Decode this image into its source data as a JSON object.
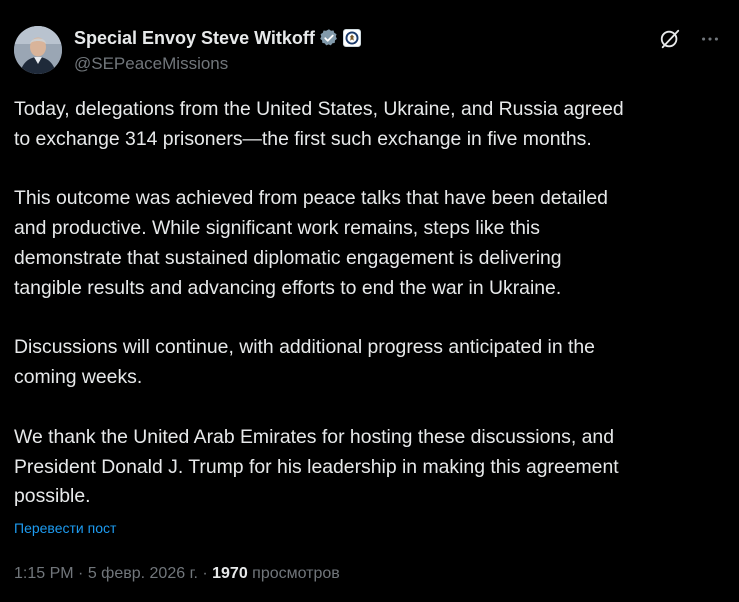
{
  "author": {
    "display_name": "Special Envoy Steve Witkoff",
    "handle": "@SEPeaceMissions",
    "verified_badge_icon": "verified-badge-icon",
    "affiliation_icon": "state-department-seal-icon"
  },
  "header_actions": {
    "grok_icon": "grok-icon",
    "more_icon": "more-icon"
  },
  "tweet": {
    "lines": [
      "Today, delegations from the United States, Ukraine, and Russia agreed",
      "to exchange 314 prisoners—the first such exchange in five months.",
      "This outcome was achieved from peace talks that have been detailed",
      "and productive. While significant work remains, steps like this",
      "demonstrate that sustained diplomatic engagement is delivering",
      "tangible results and advancing efforts to end the war in Ukraine.",
      "Discussions will continue, with additional progress anticipated in the",
      "coming weeks.",
      "We thank the United Arab Emirates for hosting these discussions, and",
      "President Donald J. Trump for his leadership in making this agreement",
      "possible."
    ]
  },
  "translate_label": "Перевести пост",
  "meta": {
    "time": "1:15 PM",
    "separator": "·",
    "date": "5 февр. 2026 г.",
    "views_count": "1970",
    "views_label": "просмотров"
  },
  "colors": {
    "background": "#000000",
    "text_primary": "#e7e9ea",
    "text_secondary": "#71767b",
    "link": "#1d9bf0"
  }
}
